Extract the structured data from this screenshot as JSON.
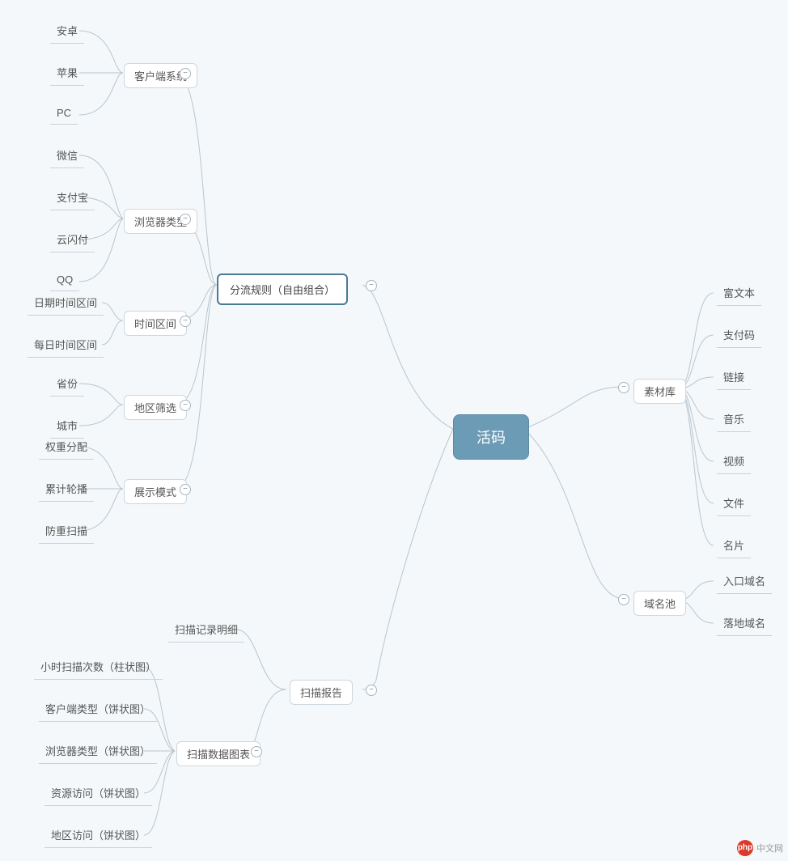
{
  "root": {
    "label": "活码"
  },
  "branches": {
    "routing": {
      "label": "分流规则（自由组合）",
      "groups": {
        "client_system": {
          "label": "客户端系统",
          "items": [
            "安卓",
            "苹果",
            "PC"
          ]
        },
        "browser_type": {
          "label": "浏览器类型",
          "items": [
            "微信",
            "支付宝",
            "云闪付",
            "QQ"
          ]
        },
        "time_span": {
          "label": "时间区间",
          "items": [
            "日期时间区间",
            "每日时间区间"
          ]
        },
        "region_filter": {
          "label": "地区筛选",
          "items": [
            "省份",
            "城市"
          ]
        },
        "display_mode": {
          "label": "展示模式",
          "items": [
            "权重分配",
            "累计轮播",
            "防重扫描"
          ]
        }
      }
    },
    "scan_report": {
      "label": "扫描报告",
      "groups": {
        "detail": {
          "label": "扫描记录明细"
        },
        "charts": {
          "label": "扫描数据图表",
          "items": [
            "小时扫描次数（柱状图）",
            "客户端类型（饼状图）",
            "浏览器类型（饼状图）",
            "资源访问（饼状图）",
            "地区访问（饼状图）"
          ]
        }
      }
    },
    "material_lib": {
      "label": "素材库",
      "items": [
        "富文本",
        "支付码",
        "链接",
        "音乐",
        "视频",
        "文件",
        "名片"
      ]
    },
    "domain_pool": {
      "label": "域名池",
      "items": [
        "入口域名",
        "落地域名"
      ]
    }
  },
  "watermark": {
    "logo_text": "php",
    "text": "中文网"
  },
  "colors": {
    "root_bg": "#6c9bb6",
    "primary_border": "#4a7a94",
    "sub_border": "#cdd7de",
    "connector": "#b8c5cf",
    "background": "#f5f8fa"
  }
}
